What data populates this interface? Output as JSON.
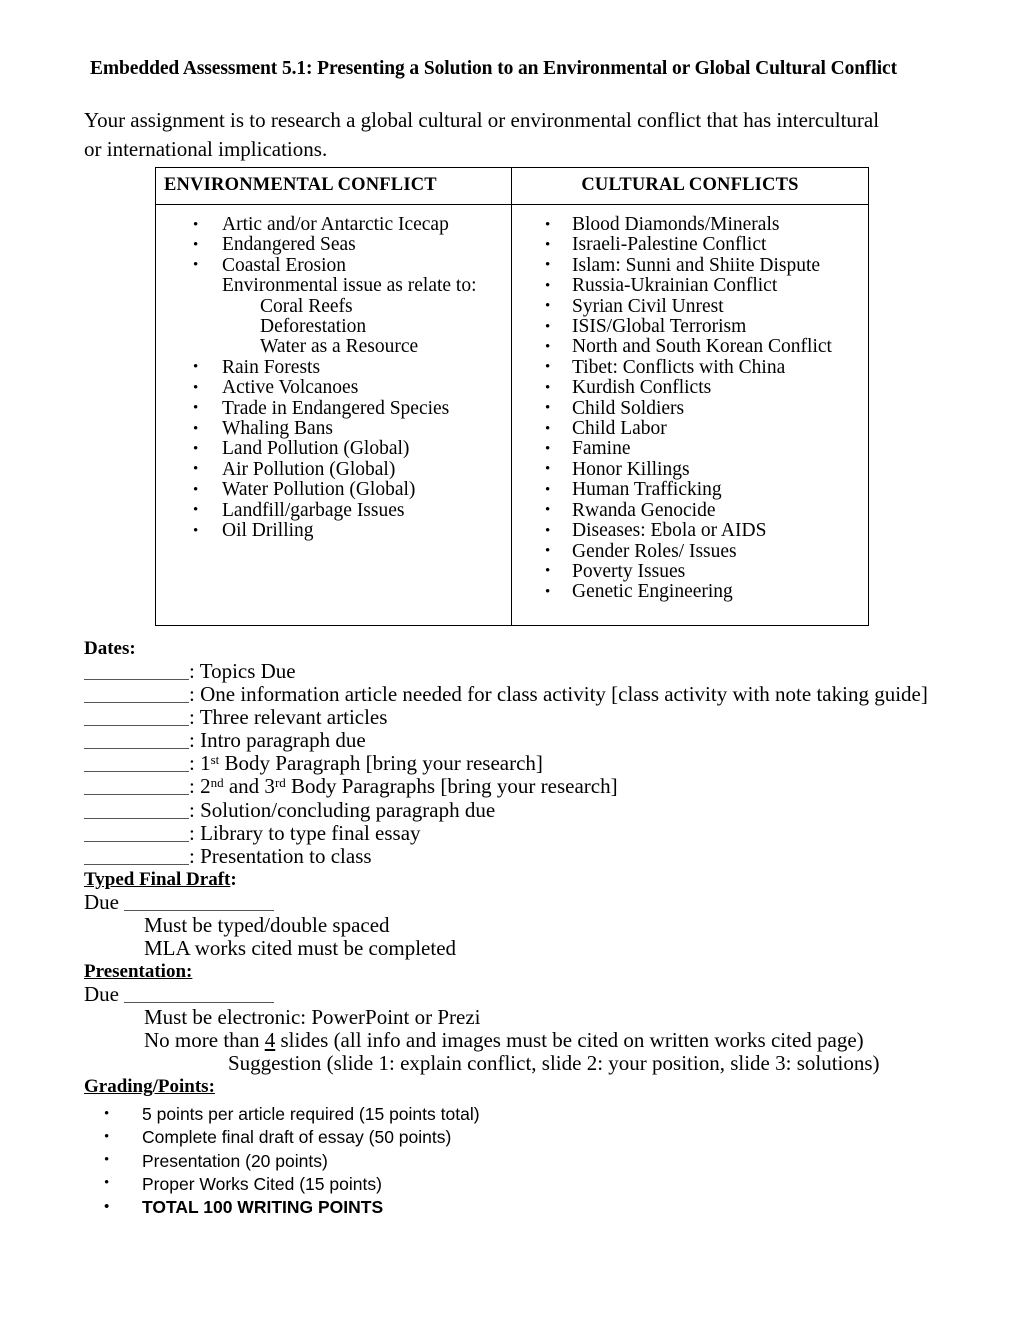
{
  "document": {
    "title": "Embedded Assessment 5.1: Presenting a Solution to an Environmental or Global Cultural Conflict",
    "intro": "Your assignment is to research a global cultural or environmental conflict that has intercultural or international implications."
  },
  "table": {
    "headers": {
      "left": "ENVIRONMENTAL CONFLICT",
      "right": "CULTURAL CONFLICTS"
    },
    "environmental": [
      {
        "text": "Artic and/or Antarctic Icecap",
        "bullet": true,
        "sub": false
      },
      {
        "text": "Endangered Seas",
        "bullet": true,
        "sub": false
      },
      {
        "text": "Coastal Erosion",
        "bullet": true,
        "sub": false
      },
      {
        "text": "Environmental issue as relate to:",
        "bullet": false,
        "sub": false
      },
      {
        "text": "Coral Reefs",
        "bullet": false,
        "sub": true
      },
      {
        "text": "Deforestation",
        "bullet": false,
        "sub": true
      },
      {
        "text": "Water as a Resource",
        "bullet": false,
        "sub": true
      },
      {
        "text": "Rain Forests",
        "bullet": true,
        "sub": false
      },
      {
        "text": "Active Volcanoes",
        "bullet": true,
        "sub": false
      },
      {
        "text": "Trade in Endangered Species",
        "bullet": true,
        "sub": false
      },
      {
        "text": "Whaling Bans",
        "bullet": true,
        "sub": false
      },
      {
        "text": "Land Pollution (Global)",
        "bullet": true,
        "sub": false
      },
      {
        "text": "Air Pollution (Global)",
        "bullet": true,
        "sub": false
      },
      {
        "text": "Water Pollution (Global)",
        "bullet": true,
        "sub": false
      },
      {
        "text": "Landfill/garbage Issues",
        "bullet": true,
        "sub": false
      },
      {
        "text": "Oil Drilling",
        "bullet": true,
        "sub": false
      }
    ],
    "cultural": [
      {
        "text": "Blood Diamonds/Minerals",
        "bullet": true,
        "sub": false
      },
      {
        "text": "Israeli-Palestine Conflict",
        "bullet": true,
        "sub": false
      },
      {
        "text": "Islam:  Sunni and Shiite Dispute",
        "bullet": true,
        "sub": false
      },
      {
        "text": "Russia-Ukrainian Conflict",
        "bullet": true,
        "sub": false
      },
      {
        "text": "Syrian Civil Unrest",
        "bullet": true,
        "sub": false
      },
      {
        "text": "ISIS/Global Terrorism",
        "bullet": true,
        "sub": false
      },
      {
        "text": "North and South Korean Conflict",
        "bullet": true,
        "sub": false
      },
      {
        "text": "Tibet: Conflicts with China",
        "bullet": true,
        "sub": false
      },
      {
        "text": "Kurdish Conflicts",
        "bullet": true,
        "sub": false
      },
      {
        "text": "Child Soldiers",
        "bullet": true,
        "sub": false
      },
      {
        "text": "Child Labor",
        "bullet": true,
        "sub": false
      },
      {
        "text": "Famine",
        "bullet": true,
        "sub": false
      },
      {
        "text": "Honor Killings",
        "bullet": true,
        "sub": false
      },
      {
        "text": "Human Trafficking",
        "bullet": true,
        "sub": false
      },
      {
        "text": "Rwanda Genocide",
        "bullet": true,
        "sub": false
      },
      {
        "text": "Diseases: Ebola or AIDS",
        "bullet": true,
        "sub": false
      },
      {
        "text": "Gender Roles/ Issues",
        "bullet": true,
        "sub": false
      },
      {
        "text": "Poverty Issues",
        "bullet": true,
        "sub": false
      },
      {
        "text": "Genetic Engineering",
        "bullet": true,
        "sub": false
      }
    ]
  },
  "dates": {
    "heading": "Dates:",
    "items": [
      {
        "label": ": Topics Due"
      },
      {
        "label": ": One information article needed for class activity [class activity with note taking guide]"
      },
      {
        "label": ": Three relevant articles"
      },
      {
        "label": ": Intro paragraph due"
      },
      {
        "label": ": 1st Body Paragraph [bring your research]",
        "sup_parts": [
          ": 1",
          "st",
          " Body Paragraph [bring your research]"
        ]
      },
      {
        "label": ": 2nd and 3rd Body Paragraphs [bring your research]",
        "sup_parts": [
          ": 2",
          "nd",
          " and 3",
          "rd",
          " Body Paragraphs [bring your research]"
        ]
      },
      {
        "label": ": Solution/concluding paragraph due"
      },
      {
        "label": ": Library to type final essay"
      },
      {
        "label": ": Presentation to class"
      }
    ]
  },
  "typed_final_draft": {
    "heading": "Typed Final Draft",
    "heading_colon": ":",
    "due_label": "Due",
    "notes": [
      "Must be typed/double spaced",
      "MLA works cited must be completed"
    ]
  },
  "presentation": {
    "heading": "Presentation:",
    "due_label": "Due",
    "note_1": "Must be electronic: PowerPoint or Prezi",
    "note_2_before": "No more than ",
    "note_2_underlined": "4",
    "note_2_after": " slides (all info and images must be cited on written works cited page)",
    "suggestion": "Suggestion (slide 1: explain conflict, slide 2: your position, slide 3: solutions)"
  },
  "grading": {
    "heading": "Grading/Points:",
    "items": [
      {
        "text": "5 points per article required (15 points total)",
        "bold": false
      },
      {
        "text": "Complete final draft of essay (50 points)",
        "bold": false
      },
      {
        "text": "Presentation (20 points)",
        "bold": false
      },
      {
        "text": "Proper Works Cited (15 points)",
        "bold": false
      },
      {
        "text": "TOTAL 100 WRITING POINTS",
        "bold": true
      }
    ]
  },
  "colors": {
    "text": "#000000",
    "page_background": "#ffffff",
    "table_border": "#000000",
    "blank_rule": "#555555"
  }
}
